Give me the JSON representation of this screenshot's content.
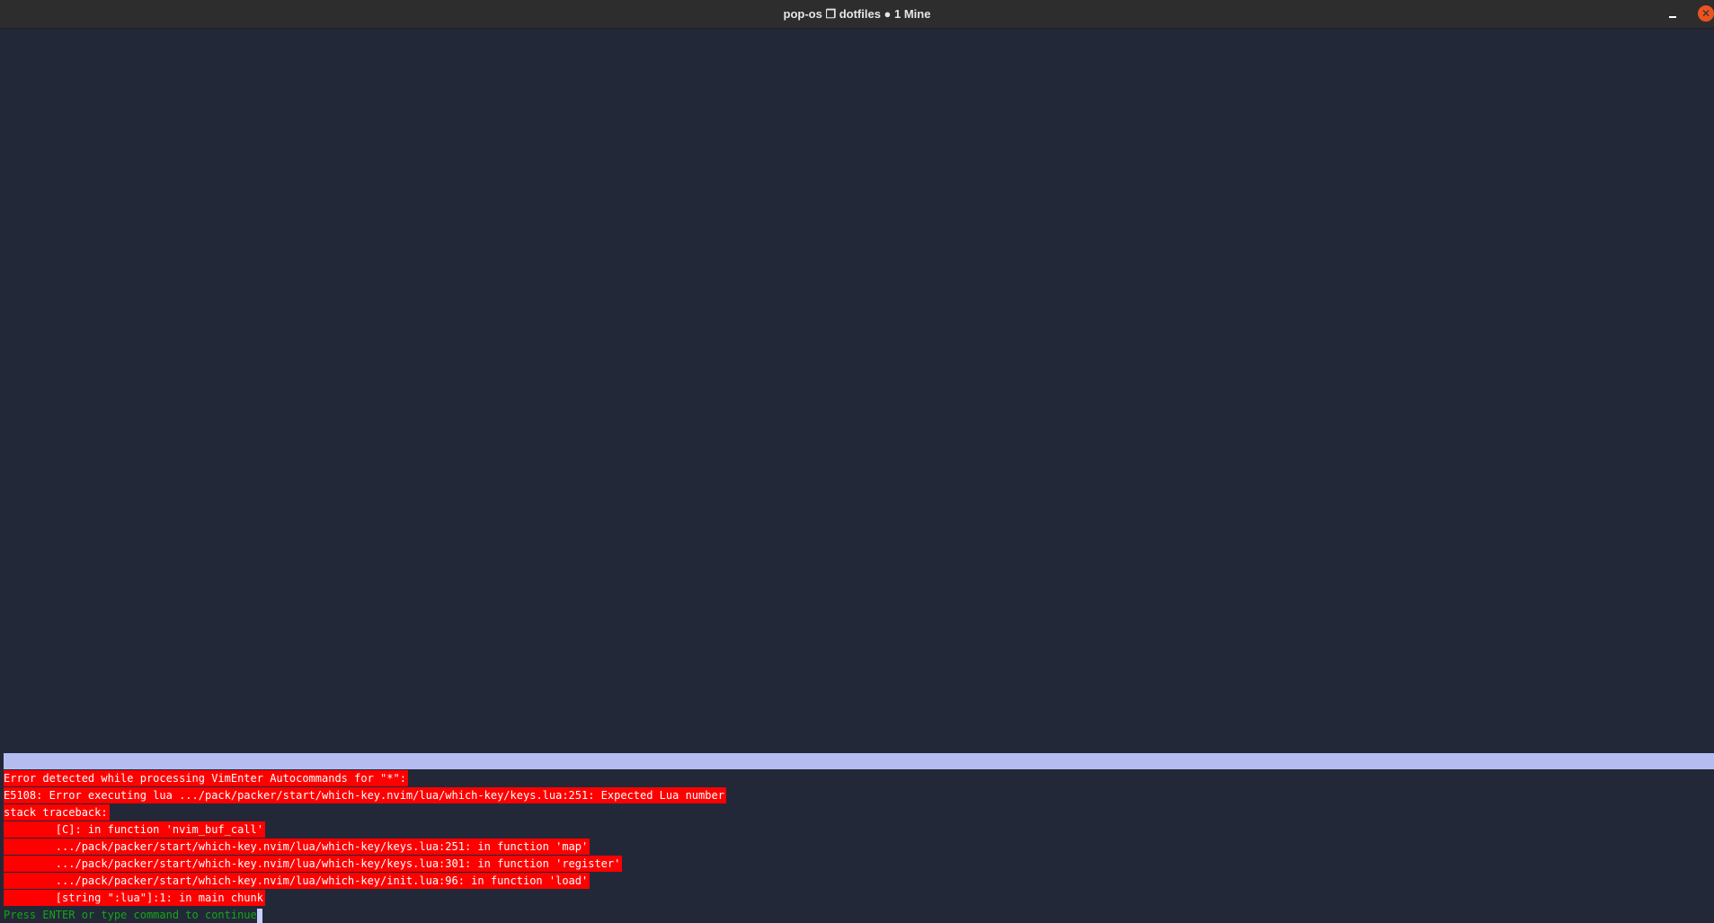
{
  "window": {
    "title": "pop-os ❐ dotfiles ● 1 Mine",
    "minimize_glyph": "",
    "close_glyph": "✕"
  },
  "messages": {
    "lines": [
      "Error detected while processing VimEnter Autocommands for \"*\":",
      "E5108: Error executing lua .../pack/packer/start/which-key.nvim/lua/which-key/keys.lua:251: Expected Lua number",
      "stack traceback:",
      "        [C]: in function 'nvim_buf_call'",
      "        .../pack/packer/start/which-key.nvim/lua/which-key/keys.lua:251: in function 'map'",
      "        .../pack/packer/start/which-key.nvim/lua/which-key/keys.lua:301: in function 'register'",
      "        .../pack/packer/start/which-key.nvim/lua/which-key/init.lua:96: in function 'load'",
      "        [string \":lua\"]:1: in main chunk"
    ],
    "prompt": "Press ENTER or type command to continue"
  },
  "colors": {
    "background": "#232838",
    "error_bg": "#ff0000",
    "error_fg": "#ffffff",
    "prompt_fg": "#15a615",
    "msg_separator": "#b5bdf0"
  }
}
